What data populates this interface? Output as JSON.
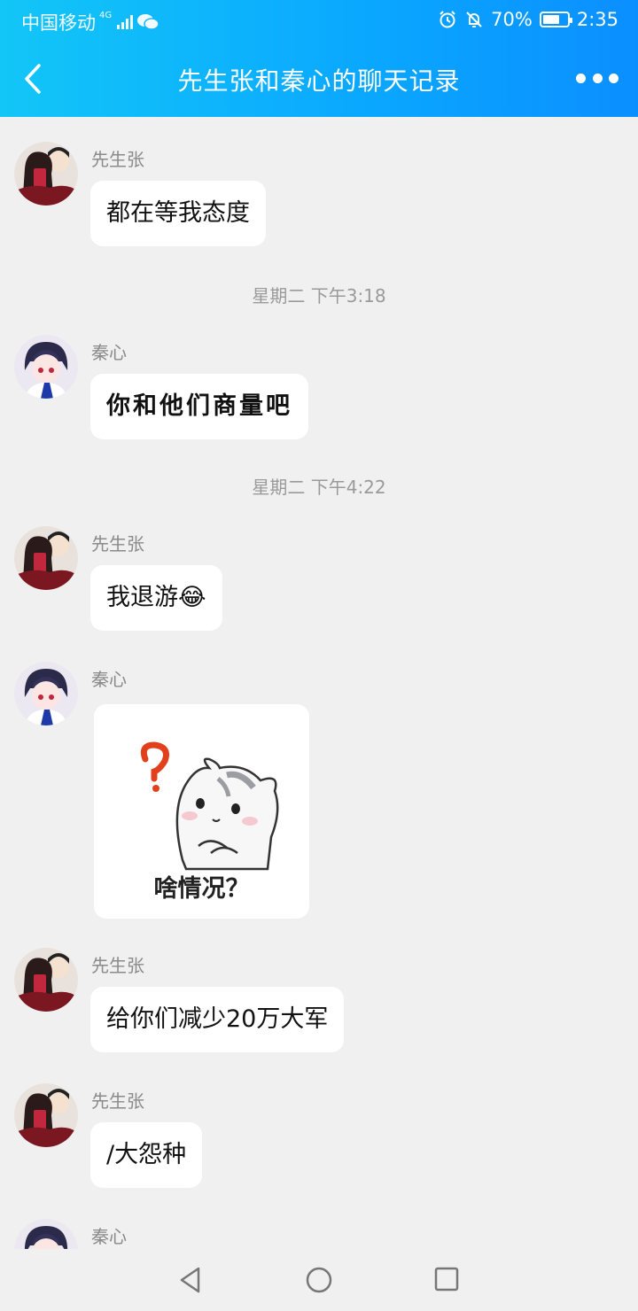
{
  "status_bar": {
    "carrier": "中国移动",
    "network": "4G",
    "battery_percent": "70%",
    "battery_level": 0.7,
    "time": "2:35",
    "icons": [
      "signal-icon",
      "wechat-icon",
      "alarm-icon",
      "mute-icon",
      "battery-icon"
    ]
  },
  "header": {
    "title": "先生张和秦心的聊天记录",
    "back_icon": "chevron-left-icon",
    "more_icon": "more-icon"
  },
  "messages": [
    {
      "sender": "先生张",
      "text": "都在等我态度"
    },
    {
      "timestamp": "星期二 下午3:18"
    },
    {
      "sender": "秦心",
      "text": "你和他们商量吧"
    },
    {
      "timestamp": "星期二 下午4:22"
    },
    {
      "sender": "先生张",
      "text": "我退游😂"
    },
    {
      "sender": "秦心",
      "sticker_caption": "啥情况？"
    },
    {
      "sender": "先生张",
      "text": "给你们减少20万大军"
    },
    {
      "sender": "先生张",
      "text": "/大怨种"
    },
    {
      "sender": "秦心"
    }
  ],
  "nav_bar": {
    "icons": [
      "back-triangle-icon",
      "home-circle-icon",
      "recents-square-icon"
    ]
  },
  "colors": {
    "header_start": "#12c6f7",
    "header_end": "#0b8fff",
    "chat_bg": "#f0f0f0",
    "bubble_bg": "#ffffff"
  }
}
